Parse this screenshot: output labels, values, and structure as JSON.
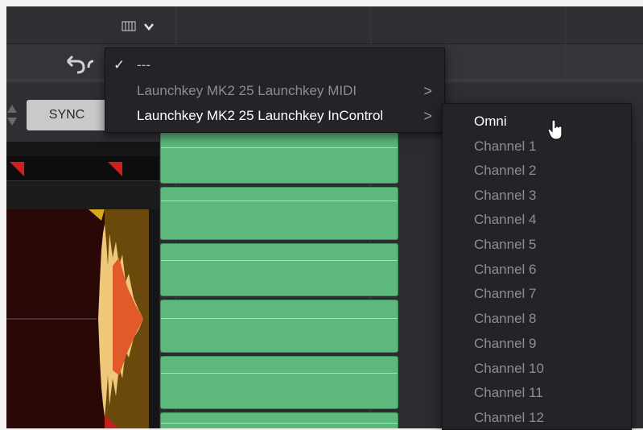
{
  "toolbar": {
    "piano_icon": "piano-keys-icon",
    "sync_label": "SYNC"
  },
  "menu": {
    "items": [
      {
        "label": "---",
        "checked": true,
        "has_submenu": false
      },
      {
        "label": "Launchkey MK2 25 Launchkey MIDI",
        "checked": false,
        "has_submenu": true
      },
      {
        "label": "Launchkey MK2 25 Launchkey InControl",
        "checked": false,
        "has_submenu": true,
        "highlighted": true
      }
    ],
    "chevron": ">"
  },
  "submenu": {
    "items": [
      {
        "label": "Omni",
        "highlighted": true
      },
      {
        "label": "Channel 1"
      },
      {
        "label": "Channel 2"
      },
      {
        "label": "Channel 3"
      },
      {
        "label": "Channel 4"
      },
      {
        "label": "Channel 5"
      },
      {
        "label": "Channel 6"
      },
      {
        "label": "Channel 7"
      },
      {
        "label": "Channel 8"
      },
      {
        "label": "Channel 9"
      },
      {
        "label": "Channel 10"
      },
      {
        "label": "Channel 11"
      },
      {
        "label": "Channel 12"
      }
    ]
  },
  "colors": {
    "clip_green": "#5db87b",
    "menu_bg": "#232427",
    "highlight_text": "#ffffff",
    "dim_text": "#8e8e8e"
  }
}
